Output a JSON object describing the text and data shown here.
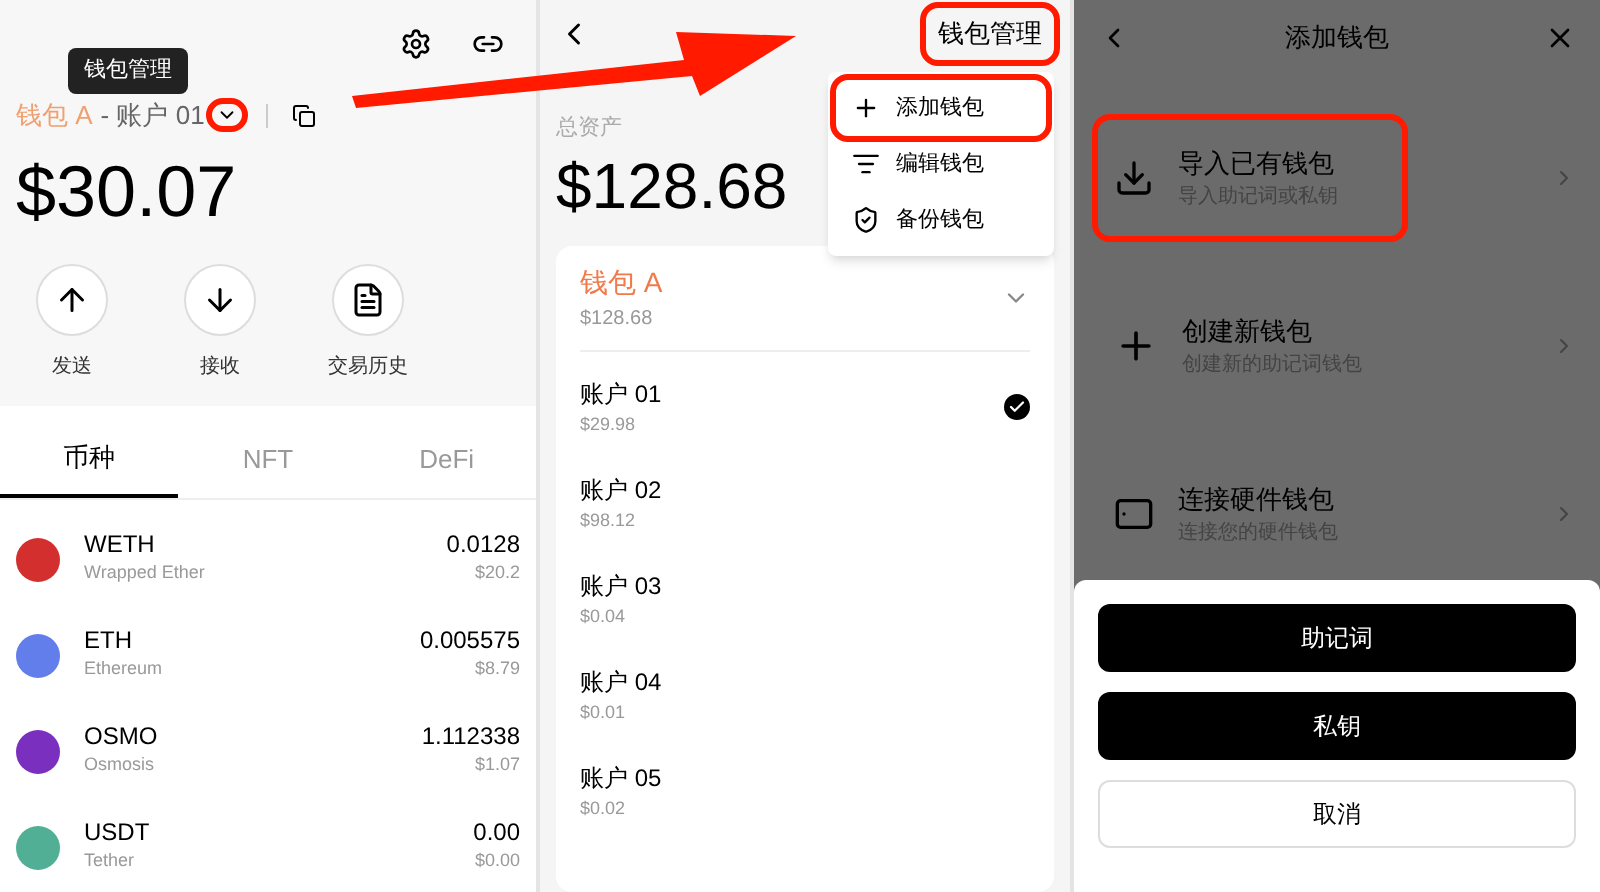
{
  "home": {
    "tooltip": "钱包管理",
    "wallet_name": "钱包 A",
    "account_name": "- 账户 01",
    "caret_annotated": true,
    "balance": "$30.07",
    "actions": [
      {
        "kind": "send",
        "label": "发送"
      },
      {
        "kind": "receive",
        "label": "接收"
      },
      {
        "kind": "history",
        "label": "交易历史"
      }
    ],
    "tabs": [
      {
        "label": "币种",
        "selected": true
      },
      {
        "label": "NFT",
        "selected": false
      },
      {
        "label": "DeFi",
        "selected": false
      }
    ],
    "tokens": [
      {
        "symbol": "WETH",
        "name": "Wrapped Ether",
        "amount": "0.0128",
        "value": "$20.2",
        "color": "#d32f2f"
      },
      {
        "symbol": "ETH",
        "name": "Ethereum",
        "amount": "0.005575",
        "value": "$8.79",
        "color": "#627eea"
      },
      {
        "symbol": "OSMO",
        "name": "Osmosis",
        "amount": "1.112338",
        "value": "$1.07",
        "color": "#7b2fbe"
      },
      {
        "symbol": "USDT",
        "name": "Tether",
        "amount": "0.00",
        "value": "$0.00",
        "color": "#50af95"
      }
    ]
  },
  "manage": {
    "title": "钱包管理",
    "title_annotated": true,
    "menu": [
      {
        "kind": "add",
        "label": "添加钱包",
        "annotated": true
      },
      {
        "kind": "edit",
        "label": "编辑钱包",
        "annotated": false
      },
      {
        "kind": "backup",
        "label": "备份钱包",
        "annotated": false
      }
    ],
    "total_label": "总资产",
    "total": "$128.68",
    "wallet": {
      "name": "钱包 A",
      "value": "$128.68",
      "expanded": true
    },
    "accounts": [
      {
        "name": "账户 01",
        "value": "$29.98",
        "selected": true
      },
      {
        "name": "账户 02",
        "value": "$98.12",
        "selected": false
      },
      {
        "name": "账户 03",
        "value": "$0.04",
        "selected": false
      },
      {
        "name": "账户 04",
        "value": "$0.01",
        "selected": false
      },
      {
        "name": "账户 05",
        "value": "$0.02",
        "selected": false
      }
    ]
  },
  "add": {
    "title": "添加钱包",
    "options": [
      {
        "kind": "import",
        "title": "导入已有钱包",
        "subtitle": "导入助记词或私钥",
        "annotated": true
      },
      {
        "kind": "create",
        "title": "创建新钱包",
        "subtitle": "创建新的助记词钱包",
        "annotated": false
      },
      {
        "kind": "hardware",
        "title": "连接硬件钱包",
        "subtitle": "连接您的硬件钱包",
        "annotated": false
      }
    ],
    "sheet": [
      {
        "kind": "primary",
        "label": "助记词"
      },
      {
        "kind": "primary",
        "label": "私钥"
      },
      {
        "kind": "outline",
        "label": "取消"
      }
    ]
  }
}
